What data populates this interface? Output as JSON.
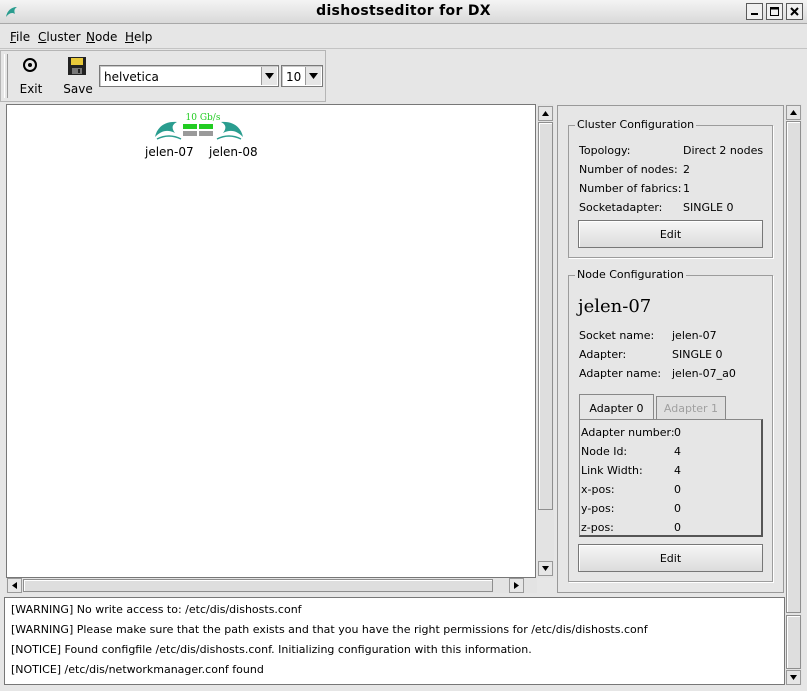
{
  "window": {
    "title": "dishostseditor for DX",
    "icon": "dolphin-icon"
  },
  "menu": [
    {
      "label": "File",
      "underline": "F"
    },
    {
      "label": "Cluster",
      "underline": "C"
    },
    {
      "label": "Node",
      "underline": "N"
    },
    {
      "label": "Help",
      "underline": "H"
    }
  ],
  "toolbar": {
    "exit_label": "Exit",
    "save_label": "Save",
    "font_family": "helvetica",
    "font_size": "10"
  },
  "canvas": {
    "link_speed": "10 Gb/s",
    "nodes": [
      {
        "name": "jelen-07"
      },
      {
        "name": "jelen-08"
      }
    ]
  },
  "cluster_config": {
    "title": "Cluster Configuration",
    "rows": [
      {
        "key": "Topology:",
        "value": "Direct 2 nodes"
      },
      {
        "key": "Number of nodes:",
        "value": "2"
      },
      {
        "key": "Number of fabrics:",
        "value": "1"
      },
      {
        "key": "Socketadapter:",
        "value": "SINGLE 0"
      }
    ],
    "edit_label": "Edit"
  },
  "node_config": {
    "title": "Node Configuration",
    "node_name": "jelen-07",
    "rows": [
      {
        "key": "Socket name:",
        "value": "jelen-07"
      },
      {
        "key": "Adapter:",
        "value": "SINGLE 0"
      },
      {
        "key": "Adapter name:",
        "value": "jelen-07_a0"
      }
    ],
    "tabs": [
      {
        "label": "Adapter 0",
        "active": true
      },
      {
        "label": "Adapter 1",
        "active": false
      }
    ],
    "adapter_rows": [
      {
        "key": "Adapter number:",
        "value": "0"
      },
      {
        "key": "Node Id:",
        "value": "4"
      },
      {
        "key": "Link Width:",
        "value": "4"
      },
      {
        "key": "x-pos:",
        "value": "0"
      },
      {
        "key": "y-pos:",
        "value": "0"
      },
      {
        "key": "z-pos:",
        "value": "0"
      }
    ],
    "edit_label": "Edit"
  },
  "log": [
    "[WARNING] No write access to: /etc/dis/dishosts.conf",
    "[WARNING] Please make sure that the path exists and that you have the right permissions for /etc/dis/dishosts.conf",
    "[NOTICE] Found configfile /etc/dis/dishosts.conf. Initializing configuration with this information.",
    "[NOTICE] /etc/dis/networkmanager.conf found"
  ],
  "colors": {
    "link_active": "#22cc22",
    "link_inactive": "#9a9a9a",
    "dolphin": "#2a9d8f",
    "disabled_text": "#a0a0a0"
  }
}
